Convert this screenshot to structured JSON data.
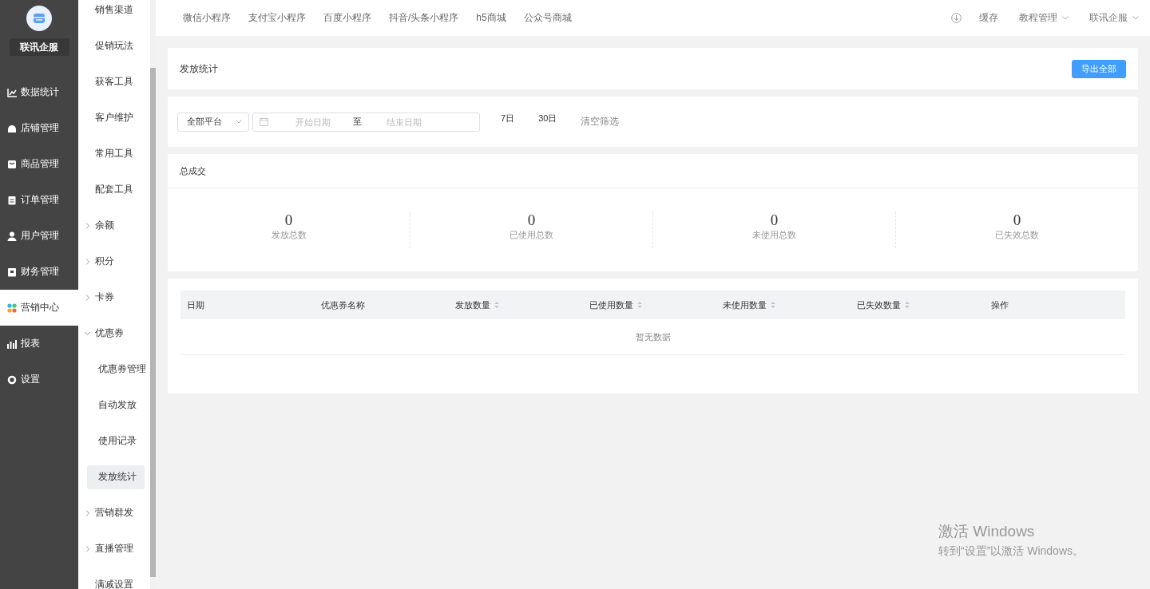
{
  "sidebar": {
    "brand": "联讯企服",
    "items": [
      {
        "label": "数据统计",
        "selected": false
      },
      {
        "label": "店铺管理",
        "selected": false
      },
      {
        "label": "商品管理",
        "selected": false
      },
      {
        "label": "订单管理",
        "selected": false
      },
      {
        "label": "用户管理",
        "selected": false
      },
      {
        "label": "财务管理",
        "selected": false
      },
      {
        "label": "营销中心",
        "selected": true
      },
      {
        "label": "报表",
        "selected": false
      },
      {
        "label": "设置",
        "selected": false
      }
    ]
  },
  "submenu": {
    "items": [
      {
        "label": "销售渠道",
        "kind": "link",
        "selected": false
      },
      {
        "label": "促销玩法",
        "kind": "link",
        "selected": false
      },
      {
        "label": "获客工具",
        "kind": "link",
        "selected": false
      },
      {
        "label": "客户维护",
        "kind": "link",
        "selected": false
      },
      {
        "label": "常用工具",
        "kind": "link",
        "selected": false
      },
      {
        "label": "配套工具",
        "kind": "link",
        "selected": false
      },
      {
        "label": "余额",
        "kind": "group",
        "expanded": false,
        "selected": false
      },
      {
        "label": "积分",
        "kind": "group",
        "expanded": false,
        "selected": false
      },
      {
        "label": "卡券",
        "kind": "group",
        "expanded": false,
        "selected": false
      },
      {
        "label": "优惠券",
        "kind": "group",
        "expanded": true,
        "selected": false,
        "children": [
          {
            "label": "优惠券管理",
            "selected": false
          },
          {
            "label": "自动发放",
            "selected": false
          },
          {
            "label": "使用记录",
            "selected": false
          },
          {
            "label": "发放统计",
            "selected": true
          }
        ]
      },
      {
        "label": "营销群发",
        "kind": "group",
        "expanded": false,
        "selected": false
      },
      {
        "label": "直播管理",
        "kind": "group",
        "expanded": false,
        "selected": false
      },
      {
        "label": "满减设置",
        "kind": "link",
        "selected": false
      }
    ]
  },
  "topbar": {
    "tabs": [
      "微信小程序",
      "支付宝小程序",
      "百度小程序",
      "抖音/头条小程序",
      "h5商城",
      "公众号商城"
    ],
    "actions": [
      {
        "label": "缓存",
        "kind": "plain"
      },
      {
        "label": "教程管理",
        "kind": "dropdown"
      },
      {
        "label": "联讯企服",
        "kind": "dropdown"
      }
    ]
  },
  "page_header": {
    "title": "发放统计",
    "export_button": "导出全部"
  },
  "filters": {
    "platform": "全部平台",
    "start_placeholder": "开始日期",
    "separator": "至",
    "end_placeholder": "结束日期",
    "quick": [
      "7日",
      "30日"
    ],
    "clear": "清空筛选"
  },
  "summary": {
    "title": "总成交",
    "stats": [
      {
        "value": "0",
        "label": "发放总数"
      },
      {
        "value": "0",
        "label": "已使用总数"
      },
      {
        "value": "0",
        "label": "未使用总数"
      },
      {
        "value": "0",
        "label": "已失效总数"
      }
    ]
  },
  "table": {
    "columns": [
      {
        "label": "日期",
        "sortable": false
      },
      {
        "label": "优惠券名称",
        "sortable": false
      },
      {
        "label": "发放数量",
        "sortable": true
      },
      {
        "label": "已使用数量",
        "sortable": true
      },
      {
        "label": "未使用数量",
        "sortable": true
      },
      {
        "label": "已失效数量",
        "sortable": true
      },
      {
        "label": "操作",
        "sortable": false
      }
    ],
    "empty_text": "暂无数据"
  },
  "os_notice": {
    "title": "激活 Windows",
    "text": "转到“设置”以激活 Windows。"
  }
}
